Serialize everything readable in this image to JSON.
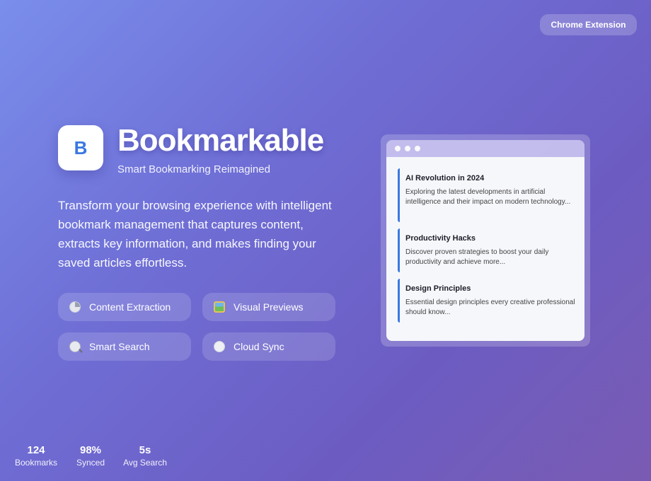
{
  "badge": {
    "label": "Chrome Extension"
  },
  "app": {
    "logo_letter": "B",
    "title": "Bookmarkable",
    "subtitle": "Smart Bookmarking Reimagined",
    "description": "Transform your browsing experience with intelligent bookmark management that captures content, extracts key information, and makes finding your saved articles effortless."
  },
  "features": [
    {
      "icon": "pie-chart-icon",
      "label": "Content Extraction"
    },
    {
      "icon": "picture-icon",
      "label": "Visual Previews"
    },
    {
      "icon": "magnifier-icon",
      "label": "Smart Search"
    },
    {
      "icon": "cloud-icon",
      "label": "Cloud Sync"
    }
  ],
  "preview": {
    "cards": [
      {
        "title": "AI Revolution in 2024",
        "text": "Exploring the latest developments in artificial intelligence and their impact on modern technology..."
      },
      {
        "title": "Productivity Hacks",
        "text": "Discover proven strategies to boost your daily productivity and achieve more..."
      },
      {
        "title": "Design Principles",
        "text": "Essential design principles every creative professional should know..."
      }
    ]
  },
  "stats": [
    {
      "value": "124",
      "label": "Bookmarks"
    },
    {
      "value": "98%",
      "label": "Synced"
    },
    {
      "value": "5s",
      "label": "Avg Search"
    }
  ],
  "colors": {
    "accent": "#3a78e0",
    "bg_start": "#7a8eeb",
    "bg_end": "#7a5bb3"
  }
}
